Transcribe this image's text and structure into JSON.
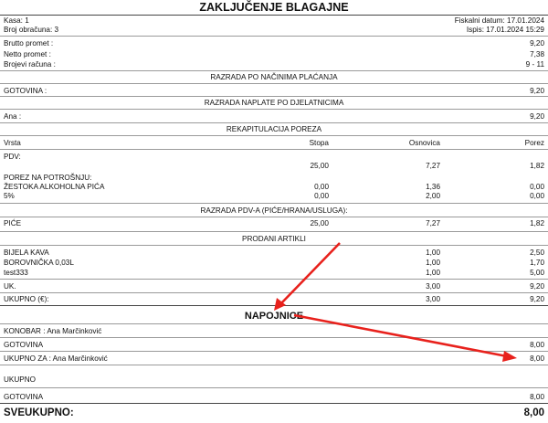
{
  "header": {
    "title": "ZAKLJUČENJE BLAGAJNE",
    "kasa": "Kasa: 1",
    "broj_obracuna": "Broj obračuna: 3",
    "fiskalni_datum": "Fiskalni datum: 17.01.2024",
    "ispis": "Ispis: 17.01.2024 15:29"
  },
  "summary": [
    {
      "label": "Brutto promet :",
      "value": "9,20"
    },
    {
      "label": "Netto promet :",
      "value": "7,38"
    },
    {
      "label": "Brojevi računa :",
      "value": "9 - 11"
    }
  ],
  "razrada_placanja": {
    "title": "RAZRADA PO NAČINIMA PLAĆANJA",
    "label": "GOTOVINA :",
    "value": "9,20"
  },
  "razrada_djelatnici": {
    "title": "RAZRADA NAPLATE PO DJELATNICIMA",
    "label": "Ana :",
    "value": "9,20"
  },
  "rekapitulacija": {
    "title": "REKAPITULACIJA POREZA",
    "col_vrsta": "Vrsta",
    "col_stopa": "Stopa",
    "col_osnovica": "Osnovica",
    "col_porez": "Porez",
    "pdv_label": "PDV:",
    "pdv_stopa": "25,00",
    "pdv_osnovica": "7,27",
    "pdv_porez": "1,82",
    "pnp_label": "POREZ NA POTROŠNJU:",
    "rows": [
      {
        "vrsta": "ŽESTOKA ALKOHOLNA PIĆA",
        "stopa": "0,00",
        "osnovica": "1,36",
        "porez": "0,00"
      },
      {
        "vrsta": "5%",
        "stopa": "0,00",
        "osnovica": "2,00",
        "porez": "0,00"
      }
    ]
  },
  "razrada_pdva": {
    "title": "RAZRADA PDV-A (PIĆE/HRANA/USLUGA):",
    "vrsta": "PIĆE",
    "stopa": "25,00",
    "osnovica": "7,27",
    "porez": "1,82"
  },
  "prodani_artikli": {
    "title": "PRODANI ARTIKLI",
    "items": [
      {
        "name": "BIJELA KAVA",
        "qty": "1,00",
        "amount": "2,50"
      },
      {
        "name": "BOROVNIČKA 0,03L",
        "qty": "1,00",
        "amount": "1,70"
      },
      {
        "name": "test333",
        "qty": "1,00",
        "amount": "5,00"
      }
    ],
    "uk_label": "UK.",
    "uk_qty": "3,00",
    "uk_amount": "9,20",
    "ukupno_label": "UKUPNO (€):",
    "ukupno_qty": "3,00",
    "ukupno_amount": "9,20"
  },
  "napojnice": {
    "title": "NAPOJNICE",
    "konobar": "KONOBAR : Ana Marčinković",
    "gotovina_label": "GOTOVINA",
    "gotovina_value": "8,00",
    "ukupno_za_label": "UKUPNO ZA : Ana Marčinković",
    "ukupno_za_value": "8,00",
    "ukupno_label": "UKUPNO",
    "gotovina2_label": "GOTOVINA",
    "gotovina2_value": "8,00"
  },
  "sveukupno": {
    "label": "SVEUKUPNO:",
    "value": "8,00"
  },
  "annotation": {
    "arrow_color": "#e8211c"
  }
}
